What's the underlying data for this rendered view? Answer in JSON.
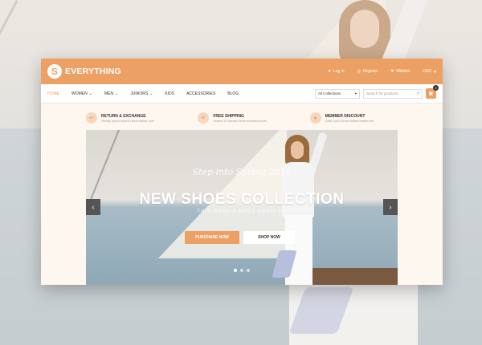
{
  "site": {
    "logo_letter": "S",
    "logo_text": "EVERYTHING",
    "top_actions": [
      {
        "icon": "user-icon",
        "label": "Log in"
      },
      {
        "icon": "key-icon",
        "label": "Register"
      },
      {
        "icon": "heart-icon",
        "label": "Wishlist"
      },
      {
        "icon": "",
        "label": "USD"
      }
    ],
    "nav": [
      {
        "label": "HOME",
        "active": true
      },
      {
        "label": "WOMEN",
        "dropdown": true
      },
      {
        "label": "MEN",
        "dropdown": true
      },
      {
        "label": "JUNIORS",
        "dropdown": true
      },
      {
        "label": "KIDS"
      },
      {
        "label": "ACCESSORIES"
      },
      {
        "label": "BLOG"
      }
    ],
    "search": {
      "collections": "All Collections",
      "placeholder": "Search for products"
    },
    "cart_count": "0",
    "features": [
      {
        "icon": "return-icon",
        "title": "RETURN & EXCHANGE",
        "subtitle": "Vintage pound cushed Lorem leather Love"
      },
      {
        "icon": "truck-icon",
        "title": "FREE SHIPPING",
        "subtitle": "Leather 10 Sweater Street oversized boots"
      },
      {
        "icon": "tag-icon",
        "title": "MEMBER DISCOUNT",
        "subtitle": "Coffe Cord 8 dress trinkets leather love"
      }
    ],
    "banner": {
      "kicker": "Step into Spring 2016",
      "title": "NEW SHOES COLLECTION",
      "subtitle": "THIS WEEK'S MOST POPULAR",
      "purchase_label": "PURCHASE NOW",
      "shop_label": "SHOP NOW"
    }
  },
  "colors": {
    "accent": "#eda063",
    "text": "#333333"
  }
}
